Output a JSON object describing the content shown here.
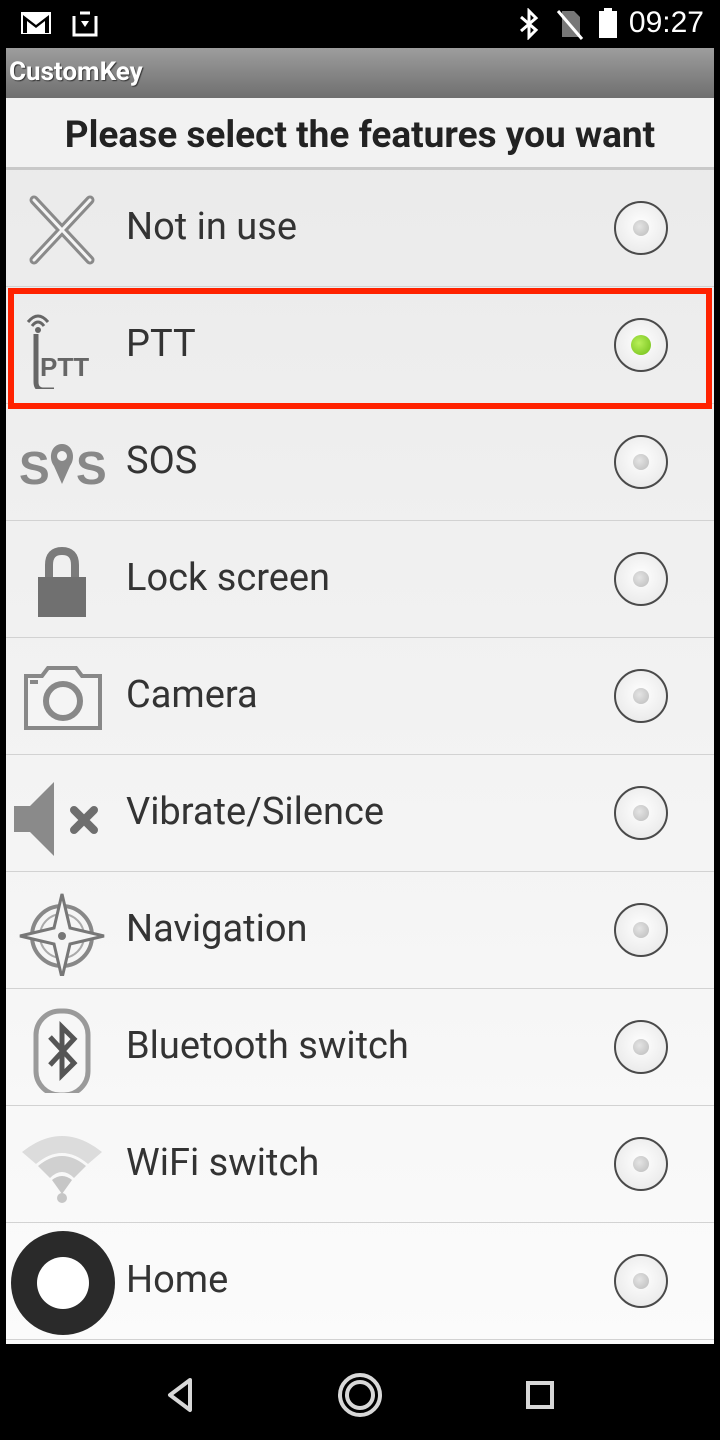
{
  "status_bar": {
    "time": "09:27",
    "icons": [
      "gmail-icon",
      "download-icon",
      "bluetooth-icon",
      "no-sim-icon",
      "battery-icon"
    ]
  },
  "app": {
    "title": "CustomKey",
    "prompt": "Please select the features you want",
    "selected_index": 1,
    "options": [
      {
        "label": "Not in use",
        "icon": "x-icon",
        "selected": false
      },
      {
        "label": "PTT",
        "icon": "ptt-icon",
        "selected": true
      },
      {
        "label": "SOS",
        "icon": "sos-icon",
        "selected": false
      },
      {
        "label": "Lock screen",
        "icon": "lock-icon",
        "selected": false
      },
      {
        "label": "Camera",
        "icon": "camera-icon",
        "selected": false
      },
      {
        "label": "Vibrate/Silence",
        "icon": "speaker-mute-icon",
        "selected": false
      },
      {
        "label": "Navigation",
        "icon": "compass-icon",
        "selected": false
      },
      {
        "label": "Bluetooth switch",
        "icon": "bluetooth-icon",
        "selected": false
      },
      {
        "label": "WiFi switch",
        "icon": "wifi-icon",
        "selected": false
      },
      {
        "label": "Home",
        "icon": "home-ring-icon",
        "selected": false
      }
    ],
    "colors": {
      "highlight": "#ff2200",
      "selected_radio": "#7fcc1f"
    }
  },
  "nav_bar": {
    "buttons": [
      "back-icon",
      "home-icon",
      "recents-icon"
    ]
  }
}
